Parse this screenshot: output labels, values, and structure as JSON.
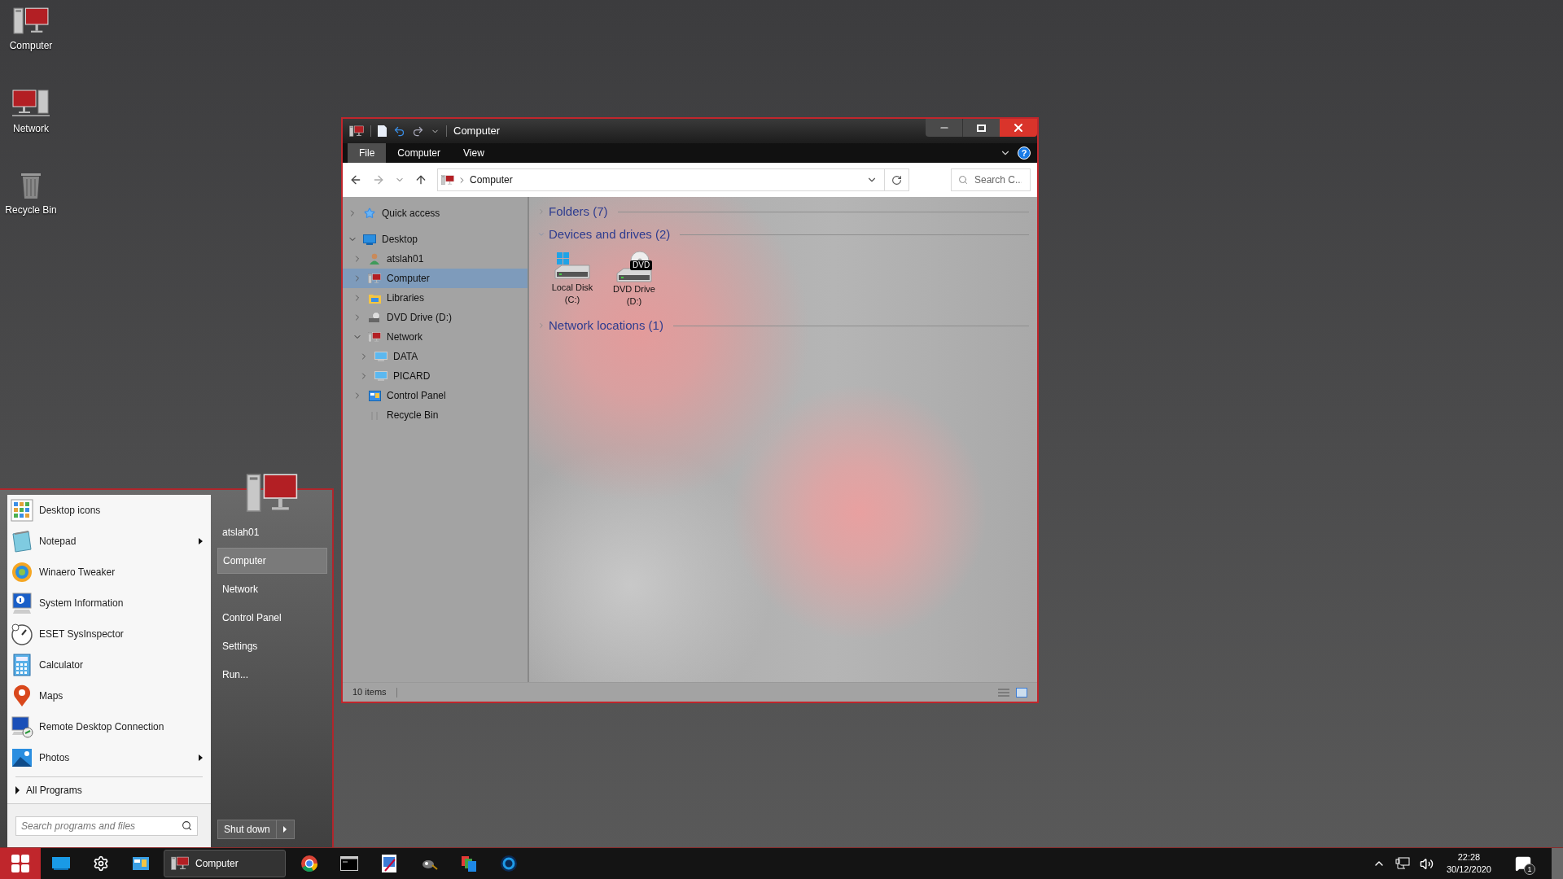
{
  "desktop_icons": [
    {
      "label": "Computer",
      "kind": "computer"
    },
    {
      "label": "Network",
      "kind": "network"
    },
    {
      "label": "Recycle Bin",
      "kind": "recycle"
    }
  ],
  "explorer": {
    "title": "Computer",
    "ribbon_tabs": [
      {
        "label": "File",
        "selected": true
      },
      {
        "label": "Computer",
        "selected": false
      },
      {
        "label": "View",
        "selected": false
      }
    ],
    "help_icon": "?",
    "address": {
      "path": "Computer"
    },
    "search": {
      "placeholder": "Search C..."
    },
    "nav_tree": [
      {
        "label": "Quick access",
        "kind": "star",
        "expandable": true,
        "expanded": false,
        "selected": false
      },
      {
        "label": "Desktop",
        "kind": "desktop",
        "expandable": true,
        "expanded": true,
        "selected": false,
        "children": [
          {
            "label": "atslah01",
            "kind": "user",
            "expandable": true,
            "expanded": false,
            "selected": false
          },
          {
            "label": "Computer",
            "kind": "computer",
            "expandable": true,
            "expanded": false,
            "selected": true
          },
          {
            "label": "Libraries",
            "kind": "folder",
            "expandable": true,
            "expanded": false,
            "selected": false
          },
          {
            "label": "DVD Drive (D:)",
            "kind": "dvd",
            "expandable": true,
            "expanded": false,
            "selected": false
          },
          {
            "label": "Network",
            "kind": "computer",
            "expandable": true,
            "expanded": true,
            "selected": false,
            "children": [
              {
                "label": "DATA",
                "kind": "monitor",
                "expandable": true,
                "expanded": false,
                "selected": false
              },
              {
                "label": "PICARD",
                "kind": "monitor",
                "expandable": true,
                "expanded": false,
                "selected": false
              }
            ]
          },
          {
            "label": "Control Panel",
            "kind": "panel",
            "expandable": true,
            "expanded": false,
            "selected": false
          },
          {
            "label": "Recycle Bin",
            "kind": "recycle",
            "expandable": false,
            "expanded": false,
            "selected": false
          }
        ]
      }
    ],
    "groups": [
      {
        "title": "Folders (7)",
        "expanded": false
      },
      {
        "title": "Devices and drives (2)",
        "expanded": true,
        "items": [
          {
            "name": "Local Disk",
            "drive": "(C:)",
            "kind": "disk"
          },
          {
            "name": "DVD Drive",
            "drive": "(D:)",
            "kind": "dvd",
            "badge": "DVD"
          }
        ]
      },
      {
        "title": "Network locations (1)",
        "expanded": false
      }
    ],
    "status_bar": {
      "count": "10 items"
    }
  },
  "start_menu": {
    "programs": [
      {
        "label": "Desktop icons",
        "kind": "grid",
        "submenu": false
      },
      {
        "label": "Notepad",
        "kind": "notepad",
        "submenu": true
      },
      {
        "label": "Winaero Tweaker",
        "kind": "swirl",
        "submenu": false
      },
      {
        "label": "System Information",
        "kind": "info",
        "submenu": false
      },
      {
        "label": "ESET SysInspector",
        "kind": "gauge",
        "submenu": false
      },
      {
        "label": "Calculator",
        "kind": "calculator",
        "submenu": false
      },
      {
        "label": "Maps",
        "kind": "pin",
        "submenu": false
      },
      {
        "label": "Remote Desktop Connection",
        "kind": "remote",
        "submenu": false
      },
      {
        "label": "Photos",
        "kind": "photos",
        "submenu": true
      }
    ],
    "all_programs": "All Programs",
    "search": {
      "placeholder": "Search programs and files"
    },
    "places": [
      {
        "label": "atslah01",
        "selected": false
      },
      {
        "label": "Computer",
        "selected": true
      },
      {
        "label": "Network",
        "selected": false
      },
      {
        "label": "Control Panel",
        "selected": false
      },
      {
        "label": "Settings",
        "selected": false
      },
      {
        "label": "Run...",
        "selected": false
      }
    ],
    "shutdown": "Shut down"
  },
  "taskbar": {
    "items": [
      {
        "kind": "desktop",
        "active": false
      },
      {
        "kind": "settings",
        "active": false
      },
      {
        "kind": "panel",
        "active": false
      },
      {
        "kind": "window",
        "label": "Computer",
        "active": true
      },
      {
        "kind": "chrome",
        "active": false
      },
      {
        "kind": "cmd",
        "active": false
      },
      {
        "kind": "paint",
        "active": false
      },
      {
        "kind": "gimp",
        "active": false
      },
      {
        "kind": "flags",
        "active": false
      },
      {
        "kind": "circle",
        "active": false
      }
    ],
    "time": "22:28",
    "date": "30/12/2020",
    "notifications": "1"
  }
}
